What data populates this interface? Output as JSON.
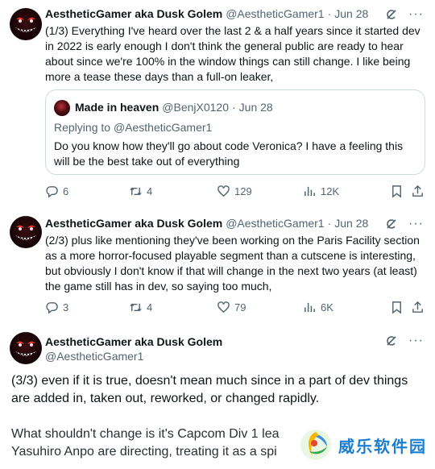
{
  "tweet1": {
    "name": "AestheticGamer aka Dusk Golem",
    "handle": "@AestheticGamer1",
    "dot": "·",
    "date": "Jun 28",
    "text": "(1/3) Everything I've heard over the last 2 & a half years since it started dev\nin 2022 is early enough I don't think the general public are ready to hear\nabout since we're 100% in the window things can still change. I like being\nmore a tease these days than a full-on leaker,",
    "quote": {
      "name": "Made in heaven",
      "handle": "@BenjX0120",
      "dot": "·",
      "date": "Jun 28",
      "replying_label": "Replying to",
      "replying_to": "@AestheticGamer1",
      "text": "Do you know how they'll go about code Veronica? I have a feeling this\nwill be the best take out of everything"
    },
    "actions": {
      "replies": "6",
      "retweets": "4",
      "likes": "129",
      "views": "12K"
    }
  },
  "tweet2": {
    "name": "AestheticGamer aka Dusk Golem",
    "handle": "@AestheticGamer1",
    "dot": "·",
    "date": "Jun 28",
    "text": "(2/3) plus like mentioning they've been working on the Paris Facility section\nas a more horror-focused playable segment than a cutscene is interesting,\nbut obviously I don't know if that will change in the next two years (at least)\nthe game still has in dev, so saying too much,",
    "actions": {
      "replies": "3",
      "retweets": "4",
      "likes": "79",
      "views": "6K"
    }
  },
  "tweet3": {
    "name": "AestheticGamer aka Dusk Golem",
    "handle": "@AestheticGamer1",
    "text": "(3/3) even if it is true, doesn't mean much since in a part of dev things\nare added in, taken out, reworked, or changed rapidly.",
    "text2": "What shouldn't change is it's Capcom Div 1 lea\nYasuhiro Anpo are directing, treating it as a spi"
  },
  "watermark": {
    "text": "威乐软件园"
  },
  "colors": {
    "accent": "#1d9bf0",
    "muted": "#536471",
    "border": "#cfd9de",
    "text": "#0f1419"
  },
  "icons": [
    "grok-icon",
    "more-icon",
    "reply-icon",
    "retweet-icon",
    "like-icon",
    "views-icon",
    "bookmark-icon",
    "share-icon"
  ]
}
